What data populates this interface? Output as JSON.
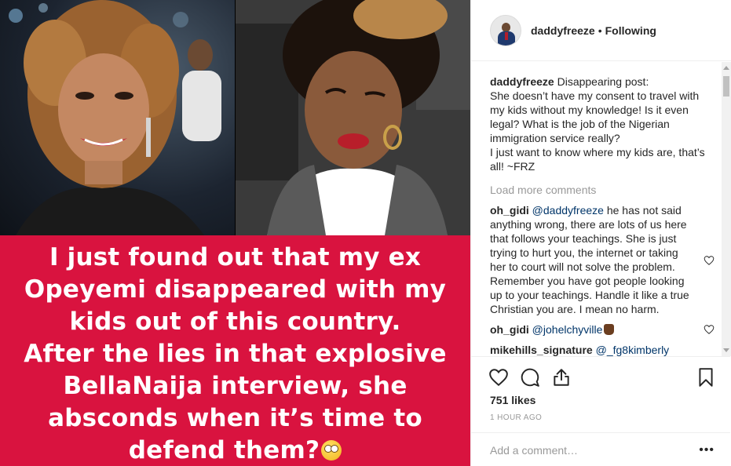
{
  "media": {
    "caption_lines": [
      "I just found out that my ex",
      "Opeyemi disappeared with my",
      "kids out of this country.",
      "After the lies in that explosive",
      "BellaNaija interview, she",
      "absconds when it’s time to",
      "defend them?"
    ],
    "caption_emoji": "face-with-rolling-eyes"
  },
  "header": {
    "username": "daddyfreeze",
    "separator": "•",
    "follow_status": "Following"
  },
  "post_caption": {
    "username": "daddyfreeze",
    "lines": [
      "Disappearing post:",
      "She doesn’t have my consent to travel with my kids without my knowledge! Is it even legal? What is the job of the Nigerian immigration service really?",
      "I just want to know where my kids are, that’s all! ~FRZ"
    ]
  },
  "load_more": "Load more comments",
  "comments": [
    {
      "username": "oh_gidi",
      "mention": "@daddyfreeze",
      "text": " he has not said anything wrong, there are lots of us here that follows your teachings. She is just trying to hurt you, the internet or taking her to court will not solve the problem. Remember you have got people looking up to your teachings. Handle it like a true Christian you are. I mean no harm."
    },
    {
      "username": "oh_gidi",
      "mention": "@johelchyville",
      "text": ""
    },
    {
      "username": "mikehills_signature",
      "mention": "@_fg8kimberly",
      "text": ""
    }
  ],
  "likes": "751 likes",
  "time": "1 HOUR AGO",
  "add_comment": {
    "placeholder": "Add a comment…",
    "more": "•••"
  },
  "colors": {
    "caption_panel": "#d9133f",
    "mention": "#003569",
    "muted": "#999999"
  }
}
